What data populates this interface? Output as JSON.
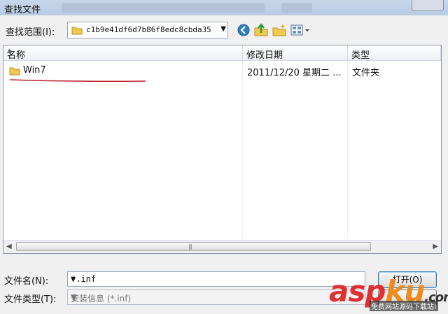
{
  "window": {
    "title": "查找文件"
  },
  "toolbar": {
    "look_in_label": "查找范围(I):",
    "look_in_value": "c1b9e41df6d7b86f8edc8cbda35",
    "icons": [
      "back-icon",
      "up-folder-icon",
      "new-folder-icon",
      "view-menu-icon"
    ]
  },
  "file_list": {
    "columns": [
      "名称",
      "修改日期",
      "类型"
    ],
    "rows": [
      {
        "name": "Win7",
        "date": "2011/12/20 星期二 ...",
        "type": "文件夹"
      }
    ]
  },
  "form": {
    "filename_label": "文件名(N):",
    "filename_value": "*.inf",
    "filetype_label": "文件类型(T):",
    "filetype_value": "安装信息 (*.inf)",
    "open_button": "打开(O)",
    "cancel_button": ""
  },
  "watermark": {
    "brand_a": "asp",
    "brand_b": "ku",
    "dot": ".com",
    "sub": "免费网站源码下载站!"
  },
  "colors": {
    "accent": "#3c7fb1",
    "annotation_underline": "#c0222a",
    "watermark_red": "#e03030",
    "watermark_orange": "#f08a1c"
  }
}
